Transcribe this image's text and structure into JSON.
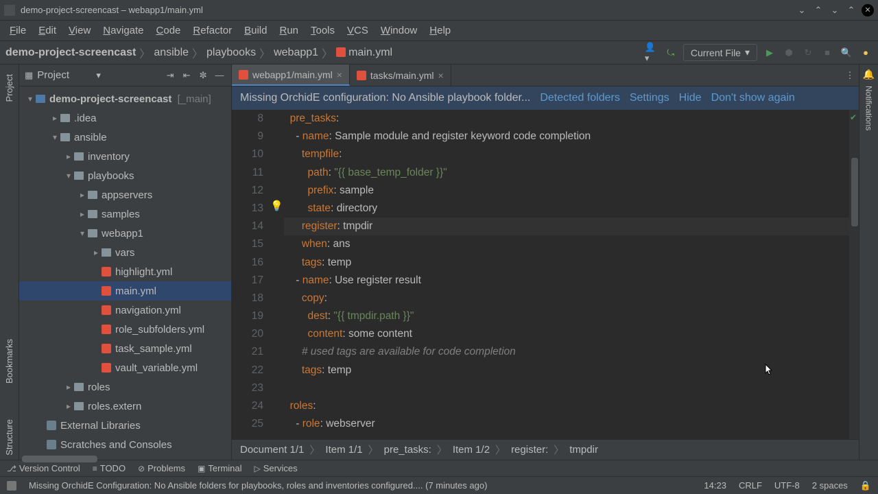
{
  "window": {
    "title": "demo-project-screencast – webapp1/main.yml"
  },
  "menu": [
    "File",
    "Edit",
    "View",
    "Navigate",
    "Code",
    "Refactor",
    "Build",
    "Run",
    "Tools",
    "VCS",
    "Window",
    "Help"
  ],
  "breadcrumbs": [
    "demo-project-screencast",
    "ansible",
    "playbooks",
    "webapp1",
    "main.yml"
  ],
  "runConfig": "Current File",
  "projectPanel": {
    "title": "Project"
  },
  "tree": {
    "root": "demo-project-screencast",
    "rootMeta": "[_main]",
    "items": [
      {
        "label": ".idea",
        "depth": 1,
        "type": "folder",
        "expand": "closed"
      },
      {
        "label": "ansible",
        "depth": 1,
        "type": "folder",
        "expand": "open"
      },
      {
        "label": "inventory",
        "depth": 2,
        "type": "folder",
        "expand": "closed"
      },
      {
        "label": "playbooks",
        "depth": 2,
        "type": "folder",
        "expand": "open"
      },
      {
        "label": "appservers",
        "depth": 3,
        "type": "folder",
        "expand": "closed"
      },
      {
        "label": "samples",
        "depth": 3,
        "type": "folder",
        "expand": "closed"
      },
      {
        "label": "webapp1",
        "depth": 3,
        "type": "folder",
        "expand": "open"
      },
      {
        "label": "vars",
        "depth": 4,
        "type": "folder",
        "expand": "closed"
      },
      {
        "label": "highlight.yml",
        "depth": 4,
        "type": "yml"
      },
      {
        "label": "main.yml",
        "depth": 4,
        "type": "yml",
        "selected": true
      },
      {
        "label": "navigation.yml",
        "depth": 4,
        "type": "yml"
      },
      {
        "label": "role_subfolders.yml",
        "depth": 4,
        "type": "yml"
      },
      {
        "label": "task_sample.yml",
        "depth": 4,
        "type": "yml"
      },
      {
        "label": "vault_variable.yml",
        "depth": 4,
        "type": "yml"
      },
      {
        "label": "roles",
        "depth": 2,
        "type": "folder",
        "expand": "closed"
      },
      {
        "label": "roles.extern",
        "depth": 2,
        "type": "folder",
        "expand": "closed"
      },
      {
        "label": "External Libraries",
        "depth": 0,
        "type": "lib"
      },
      {
        "label": "Scratches and Consoles",
        "depth": 0,
        "type": "lib"
      }
    ]
  },
  "tabs": [
    {
      "label": "webapp1/main.yml",
      "active": true
    },
    {
      "label": "tasks/main.yml",
      "active": false
    }
  ],
  "banner": {
    "msg": "Missing OrchidE configuration: No Ansible playbook folder...",
    "links": [
      "Detected folders",
      "Settings",
      "Hide",
      "Don't show again"
    ]
  },
  "code": {
    "startLine": 8,
    "lines": [
      [
        {
          "t": "  ",
          "c": ""
        },
        {
          "t": "pre_tasks",
          "c": "key"
        },
        {
          "t": ":",
          "c": "val"
        }
      ],
      [
        {
          "t": "    - ",
          "c": "val"
        },
        {
          "t": "name",
          "c": "key"
        },
        {
          "t": ": ",
          "c": "val"
        },
        {
          "t": "Sample module and register keyword code completion",
          "c": "val"
        }
      ],
      [
        {
          "t": "      ",
          "c": ""
        },
        {
          "t": "tempfile",
          "c": "key"
        },
        {
          "t": ":",
          "c": "val"
        }
      ],
      [
        {
          "t": "        ",
          "c": ""
        },
        {
          "t": "path",
          "c": "key"
        },
        {
          "t": ": ",
          "c": "val"
        },
        {
          "t": "\"{{ base_temp_folder }}\"",
          "c": "str"
        }
      ],
      [
        {
          "t": "        ",
          "c": ""
        },
        {
          "t": "prefix",
          "c": "key"
        },
        {
          "t": ": ",
          "c": "val"
        },
        {
          "t": "sample",
          "c": "val"
        }
      ],
      [
        {
          "t": "        ",
          "c": ""
        },
        {
          "t": "state",
          "c": "key"
        },
        {
          "t": ": ",
          "c": "val"
        },
        {
          "t": "directory",
          "c": "val"
        }
      ],
      [
        {
          "t": "      ",
          "c": ""
        },
        {
          "t": "register",
          "c": "key"
        },
        {
          "t": ": ",
          "c": "val"
        },
        {
          "t": "tmpdir",
          "c": "val"
        }
      ],
      [
        {
          "t": "      ",
          "c": ""
        },
        {
          "t": "when",
          "c": "key"
        },
        {
          "t": ": ",
          "c": "val"
        },
        {
          "t": "ans",
          "c": "val"
        }
      ],
      [
        {
          "t": "      ",
          "c": ""
        },
        {
          "t": "tags",
          "c": "key"
        },
        {
          "t": ": ",
          "c": "val"
        },
        {
          "t": "temp",
          "c": "val"
        }
      ],
      [
        {
          "t": "    - ",
          "c": "val"
        },
        {
          "t": "name",
          "c": "key"
        },
        {
          "t": ": ",
          "c": "val"
        },
        {
          "t": "Use register result",
          "c": "val"
        }
      ],
      [
        {
          "t": "      ",
          "c": ""
        },
        {
          "t": "copy",
          "c": "key"
        },
        {
          "t": ":",
          "c": "val"
        }
      ],
      [
        {
          "t": "        ",
          "c": ""
        },
        {
          "t": "dest",
          "c": "key"
        },
        {
          "t": ": ",
          "c": "val"
        },
        {
          "t": "\"{{ tmpdir.path }}\"",
          "c": "str"
        }
      ],
      [
        {
          "t": "        ",
          "c": ""
        },
        {
          "t": "content",
          "c": "key"
        },
        {
          "t": ": ",
          "c": "val"
        },
        {
          "t": "some content",
          "c": "val"
        }
      ],
      [
        {
          "t": "      ",
          "c": ""
        },
        {
          "t": "# used tags are available for code completion",
          "c": "cmt"
        }
      ],
      [
        {
          "t": "      ",
          "c": ""
        },
        {
          "t": "tags",
          "c": "key"
        },
        {
          "t": ": ",
          "c": "val"
        },
        {
          "t": "temp",
          "c": "val"
        }
      ],
      [],
      [
        {
          "t": "  ",
          "c": ""
        },
        {
          "t": "roles",
          "c": "key"
        },
        {
          "t": ":",
          "c": "val"
        }
      ],
      [
        {
          "t": "    - ",
          "c": "val"
        },
        {
          "t": "role",
          "c": "key"
        },
        {
          "t": ": ",
          "c": "val"
        },
        {
          "t": "webserver",
          "c": "val"
        }
      ]
    ],
    "highlight": 14
  },
  "editorCrumbs": [
    "Document 1/1",
    "Item 1/1",
    "pre_tasks:",
    "Item 1/2",
    "register:",
    "tmpdir"
  ],
  "sideLabels": {
    "project": "Project",
    "bookmarks": "Bookmarks",
    "structure": "Structure",
    "notifications": "Notifications"
  },
  "bottomTools": [
    {
      "label": "Version Control",
      "ico": "⎇"
    },
    {
      "label": "TODO",
      "ico": "≡"
    },
    {
      "label": "Problems",
      "ico": "⊘"
    },
    {
      "label": "Terminal",
      "ico": "▣"
    },
    {
      "label": "Services",
      "ico": "▷"
    }
  ],
  "status": {
    "msg": "Missing OrchidE Configuration: No Ansible folders for playbooks, roles and inventories configured.... (7 minutes ago)",
    "pos": "14:23",
    "eol": "CRLF",
    "enc": "UTF-8",
    "indent": "2 spaces"
  }
}
